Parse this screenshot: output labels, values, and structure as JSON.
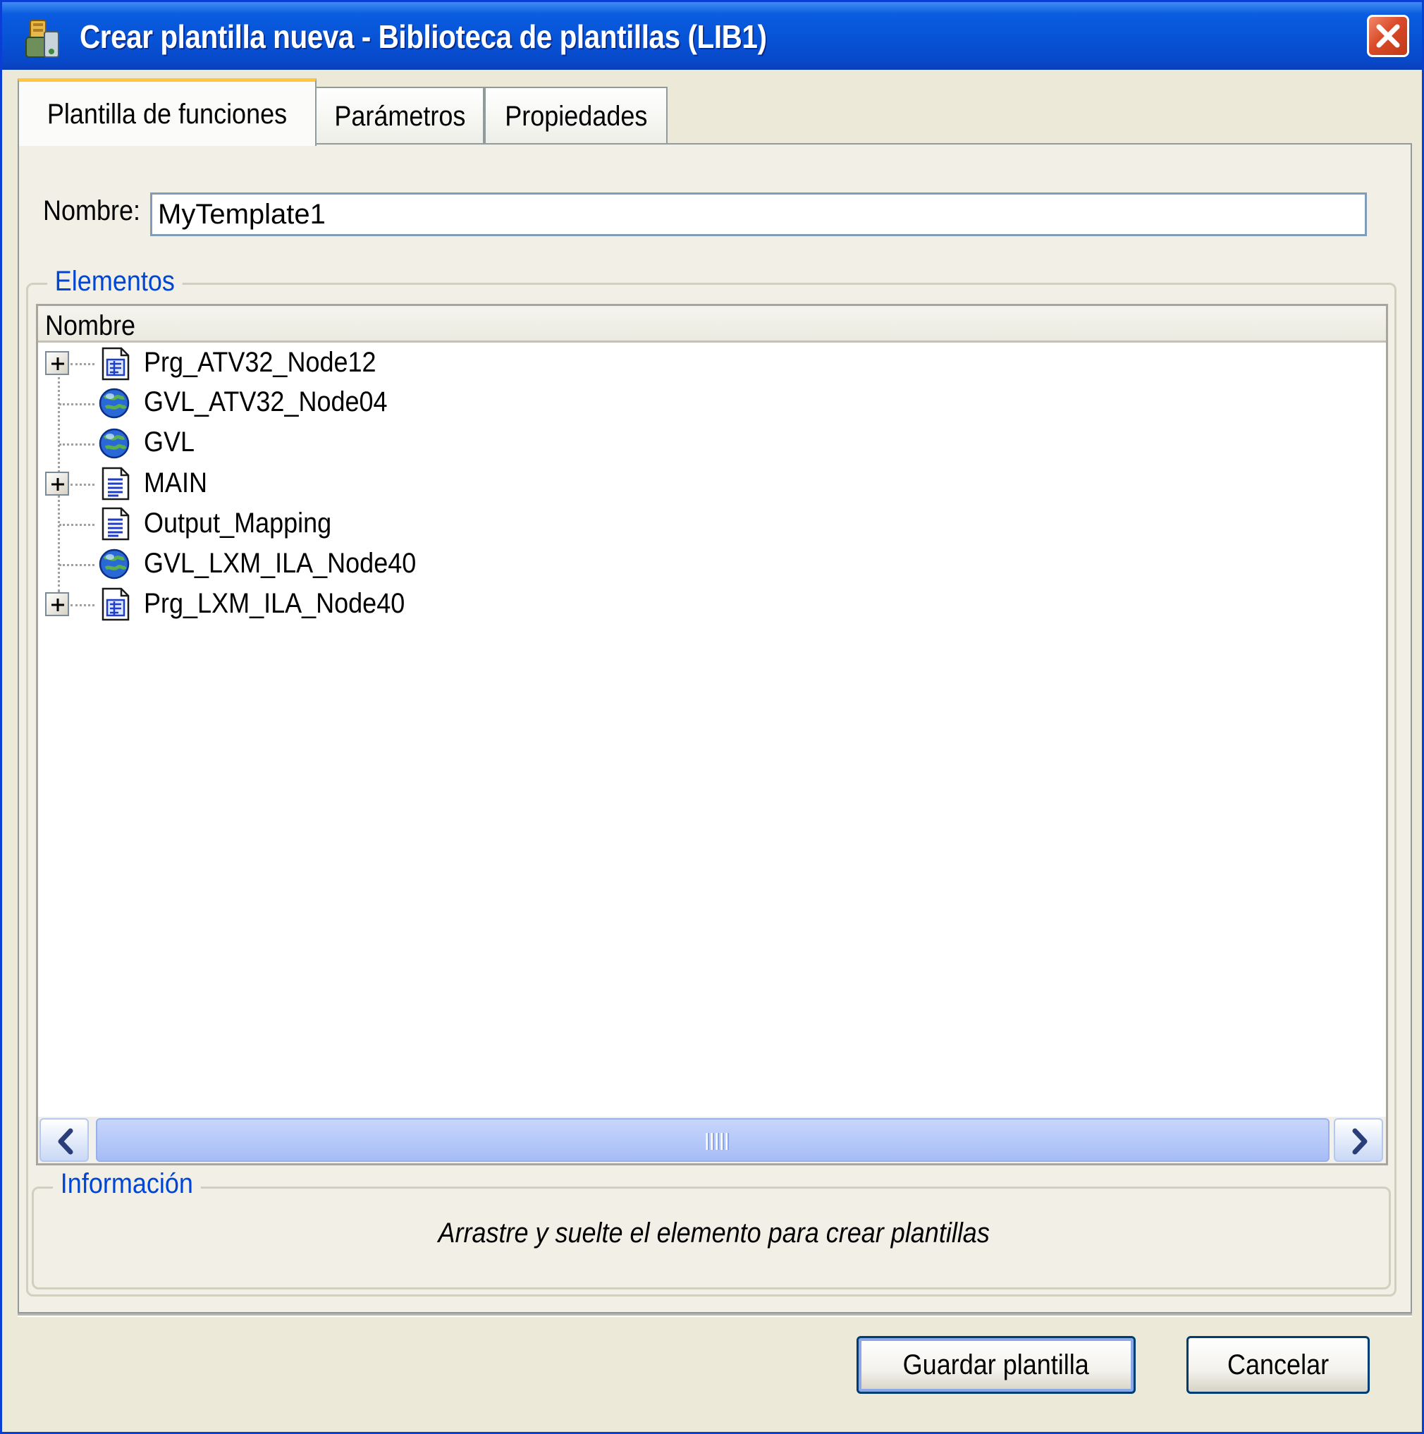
{
  "window": {
    "title": "Crear plantilla nueva - Biblioteca de plantillas (LIB1)",
    "accent_color": "#0a5ce0",
    "close_icon": "close-icon"
  },
  "tabs": [
    {
      "label": "Plantilla de funciones",
      "active": true
    },
    {
      "label": "Parámetros",
      "active": false
    },
    {
      "label": "Propiedades",
      "active": false
    }
  ],
  "form": {
    "name_label": "Nombre:",
    "name_value": "MyTemplate1"
  },
  "elements": {
    "group_title": "Elementos",
    "column_header": "Nombre",
    "items": [
      {
        "label": "Prg_ATV32_Node12",
        "icon": "program-icon",
        "expandable": true
      },
      {
        "label": "GVL_ATV32_Node04",
        "icon": "globe-icon",
        "expandable": false
      },
      {
        "label": "GVL",
        "icon": "globe-icon",
        "expandable": false
      },
      {
        "label": "MAIN",
        "icon": "document-icon",
        "expandable": true
      },
      {
        "label": "Output_Mapping",
        "icon": "document-icon",
        "expandable": false
      },
      {
        "label": "GVL_LXM_ILA_Node40",
        "icon": "globe-icon",
        "expandable": false
      },
      {
        "label": "Prg_LXM_ILA_Node40",
        "icon": "program-icon",
        "expandable": true
      }
    ]
  },
  "info": {
    "group_title": "Información",
    "text": "Arrastre y suelte el elemento para crear plantillas"
  },
  "buttons": {
    "save": "Guardar plantilla",
    "cancel": "Cancelar"
  }
}
